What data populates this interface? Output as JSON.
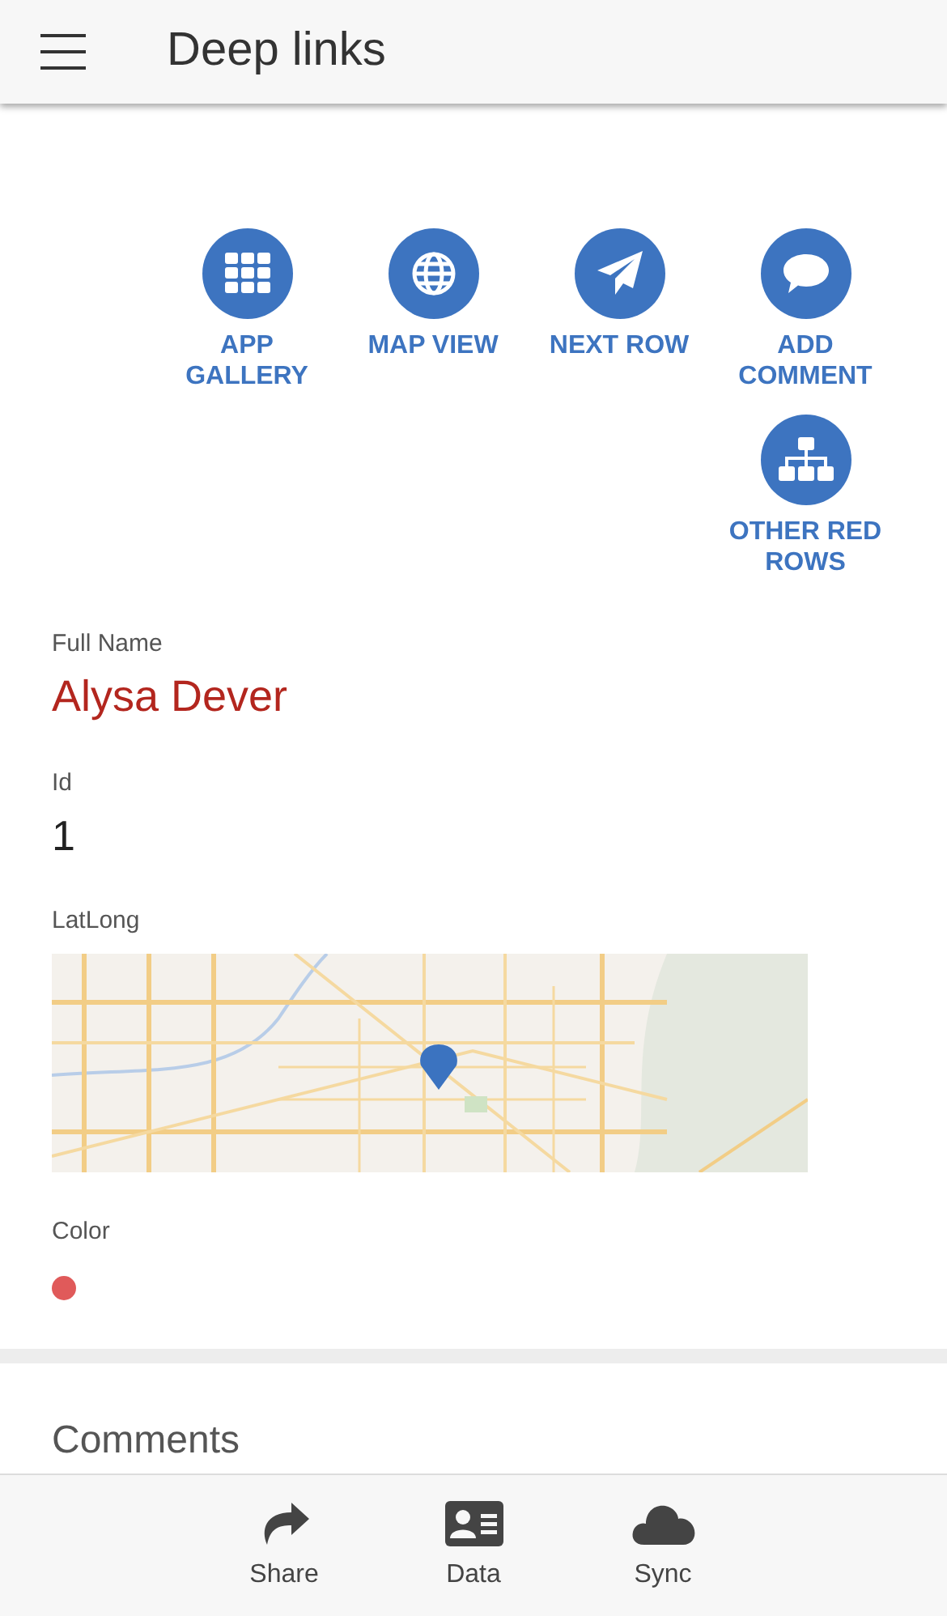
{
  "header": {
    "title": "Deep links"
  },
  "actions": [
    {
      "label": "APP GALLERY",
      "kind": "grid"
    },
    {
      "label": "MAP VIEW",
      "kind": "globe"
    },
    {
      "label": "NEXT ROW",
      "kind": "send"
    },
    {
      "label": "ADD COMMENT",
      "kind": "comment"
    },
    {
      "label": "OTHER RED ROWS",
      "kind": "sitemap"
    }
  ],
  "fields": [
    {
      "kind": "name",
      "label": "Full Name",
      "value": "Alysa Dever"
    },
    {
      "kind": "number",
      "label": "Id",
      "value": "1"
    },
    {
      "kind": "map",
      "label": "LatLong"
    },
    {
      "kind": "color",
      "label": "Color",
      "color": "#e05a5a"
    }
  ],
  "comments": {
    "title": "Comments"
  },
  "bottom_nav": [
    {
      "label": "Share",
      "kind": "share"
    },
    {
      "label": "Data",
      "kind": "card"
    },
    {
      "label": "Sync",
      "kind": "cloud"
    }
  ]
}
